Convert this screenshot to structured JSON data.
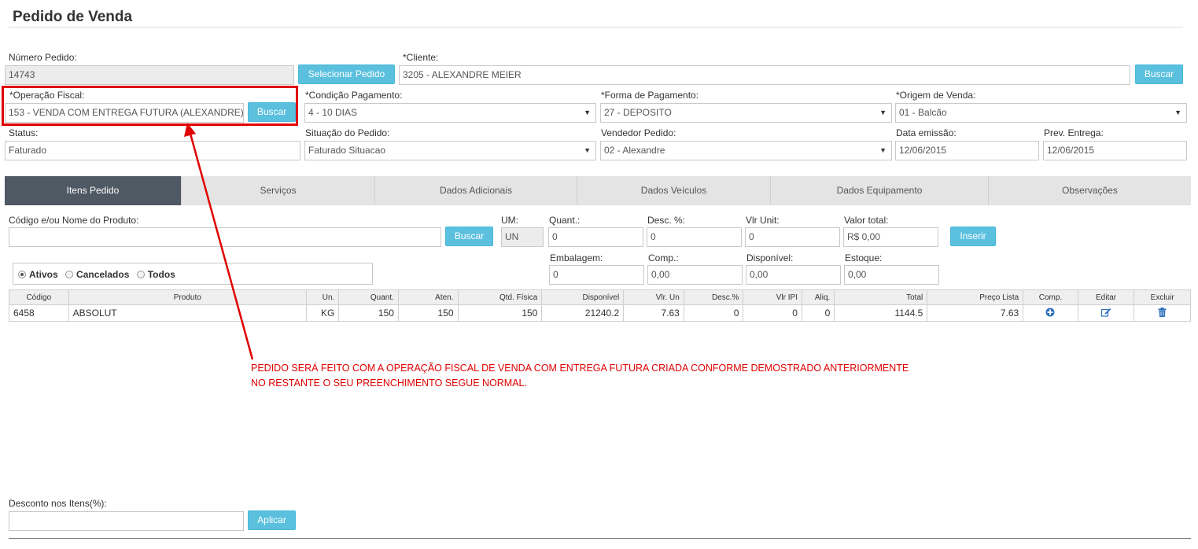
{
  "page": {
    "title": "Pedido de Venda"
  },
  "header": {
    "numero_label": "Número Pedido:",
    "numero_value": "14743",
    "selecionar_label": "Selecionar Pedido",
    "cliente_label": "*Cliente:",
    "cliente_value": "3205 - ALEXANDRE MEIER",
    "buscar_cliente_label": "Buscar",
    "operacao_label": "*Operação Fiscal:",
    "operacao_value": "153 - VENDA COM ENTREGA FUTURA (ALEXANDRE)",
    "buscar_operacao_label": "Buscar",
    "condicao_label": "*Condição Pagamento:",
    "condicao_value": "4 - 10 DIAS",
    "forma_label": "*Forma de Pagamento:",
    "forma_value": "27 - DEPOSITO",
    "origem_label": "*Origem de Venda:",
    "origem_value": "01 - Balcão",
    "status_label": "Status:",
    "status_value": "Faturado",
    "situacao_label": "Situação do Pedido:",
    "situacao_value": "Faturado Situacao",
    "vendedor_label": "Vendedor Pedido:",
    "vendedor_value": "02 - Alexandre",
    "emissao_label": "Data emissão:",
    "emissao_value": "12/06/2015",
    "entrega_label": "Prev. Entrega:",
    "entrega_value": "12/06/2015"
  },
  "tabs": [
    {
      "label": "Itens Pedido"
    },
    {
      "label": "Serviços"
    },
    {
      "label": "Dados Adicionais"
    },
    {
      "label": "Dados Veículos"
    },
    {
      "label": "Dados Equipamento"
    },
    {
      "label": "Observações"
    }
  ],
  "item_form": {
    "produto_label": "Código e/ou Nome do Produto:",
    "produto_value": "",
    "buscar_label": "Buscar",
    "um_label": "UM:",
    "um_value": "UN",
    "quant_label": "Quant.:",
    "quant_value": "0",
    "desc_label": "Desc. %:",
    "desc_value": "0",
    "vlr_unit_label": "Vlr Unit:",
    "vlr_unit_value": "0",
    "valor_total_label": "Valor total:",
    "valor_total_value": "R$ 0,00",
    "inserir_label": "Inserir",
    "embalagem_label": "Embalagem:",
    "embalagem_value": "0",
    "comp_label": "Comp.:",
    "comp_value": "0,00",
    "disponivel_label": "Disponível:",
    "disponivel_value": "0,00",
    "estoque_label": "Estoque:",
    "estoque_value": "0,00"
  },
  "filter": {
    "ativos": "Ativos",
    "cancelados": "Cancelados",
    "todos": "Todos",
    "selected": "Ativos"
  },
  "table": {
    "headers": [
      "Código",
      "Produto",
      "Un.",
      "Quant.",
      "Aten.",
      "Qtd. Física",
      "Disponível",
      "Vlr. Un",
      "Desc.%",
      "Vlr IPI",
      "Aliq.",
      "Total",
      "Preço Lista",
      "Comp.",
      "Editar",
      "Excluir"
    ],
    "rows": [
      [
        "6458",
        "ABSOLUT",
        "KG",
        "150",
        "150",
        "150",
        "21240.2",
        "7.63",
        "0",
        "0",
        "0",
        "1144.5",
        "7.63"
      ]
    ]
  },
  "annotation": {
    "line1": "PEDIDO SERÁ FEITO COM A OPERAÇÃO FISCAL DE VENDA COM ENTREGA FUTURA CRIADA CONFORME DEMOSTRADO ANTERIORMENTE",
    "line2": "NO RESTANTE O SEU PREENCHIMENTO SEGUE NORMAL.",
    "color": "#e00000"
  },
  "footer": {
    "desconto_label": "Desconto nos Itens(%):",
    "desconto_value": "",
    "aplicar_label": "Aplicar"
  },
  "colors": {
    "button": "#5bc0de",
    "active_tab": "#4f5963",
    "highlight": "#e00000"
  },
  "icons": {
    "comp": "plus-circle-icon",
    "edit": "edit-icon",
    "delete": "trash-icon"
  }
}
